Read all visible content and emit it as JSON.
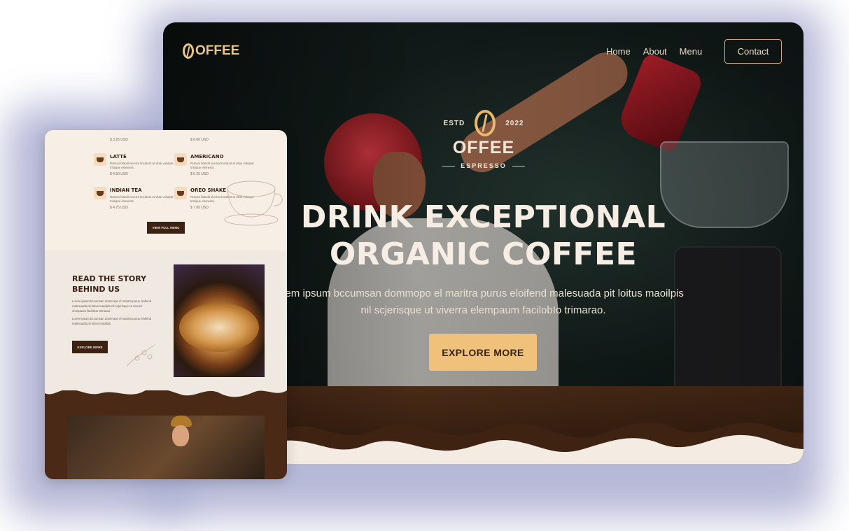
{
  "site": {
    "logo_text": "OFFEE",
    "nav": [
      "Home",
      "About",
      "Menu"
    ],
    "contact_label": "Contact"
  },
  "hero": {
    "estd": "ESTD",
    "year": "2022",
    "brand": "OFFEE",
    "tagline": "ESPRESSO",
    "headline_1": "DRINK EXCEPTIONAL",
    "headline_2": "ORGANIC COFFEE",
    "paragraph_1": "orem ipsum bccumsan dommopo el maritra purus eloifend malesuada pit loitus maoilpis",
    "paragraph_2": "nil scjerisque ut viverra elempaum facilobIo trimarao.",
    "cta": "EXPLORE MORE"
  },
  "mobile": {
    "menu_items": [
      {
        "name": "LATTE",
        "desc": "Rutrum blandit viverra tincidunt at vitae volutpat tristique elements.",
        "price": "$ 4.50 USD"
      },
      {
        "name": "AMERICANO",
        "desc": "Rutrum blandit viverra tincidunt at vitae volutpat tristique elements.",
        "price": "$ 6.25 USD"
      },
      {
        "name": "INDIAN TEA",
        "desc": "Rutrum blandit viverra tincidunt at vitae volutpat tristique elements.",
        "price": "$ 4.75 USD"
      },
      {
        "name": "OREO SHAKE",
        "desc": "Rutrum blandit viverra tincidunt at vitae volutpat tristique elements.",
        "price": "$ 7.00 USD"
      }
    ],
    "top_prices": [
      "$ 3.25 USD",
      "$ 6.00 USD"
    ],
    "view_full_menu": "VIEW FULL MENU",
    "story_title": "READ THE STORY BEHIND US",
    "story_para_1": "Lorem ipsum bccumsan dommopo el maritra purus eloifend malesuada pit loitus maoilpis nil scjerisque ut viverra elempaum facilobIo trimarao.",
    "story_para_2": "Lorem ipsum bccumsan dommopo el maritra purus eloifend malesuada pit loitus maoilpis.",
    "explore_more": "EXPLORE MORE"
  },
  "colors": {
    "accent": "#f0c17a",
    "gold": "#e8c58a",
    "dark_brown": "#3c2212",
    "cream": "#f7efe6"
  }
}
